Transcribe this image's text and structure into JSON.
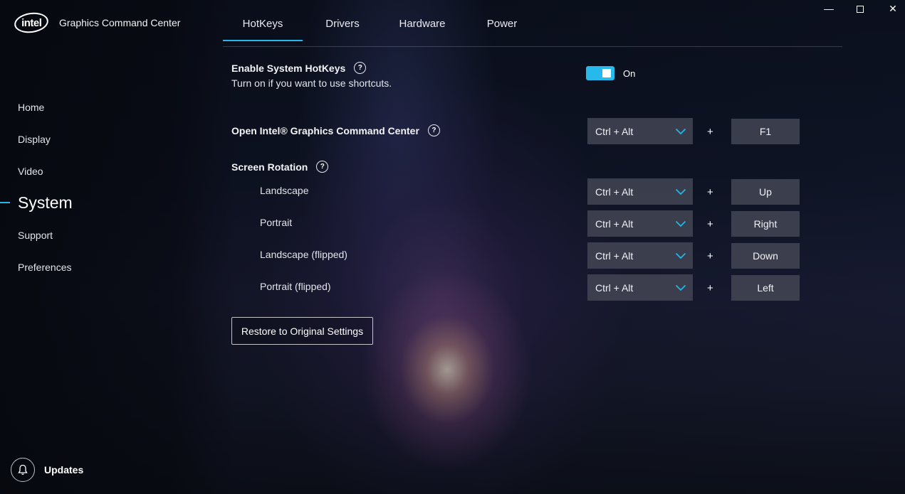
{
  "app": {
    "logo_text": "intel",
    "title": "Graphics Command Center"
  },
  "window_controls": {
    "minimize": "—",
    "close": "✕"
  },
  "tabs": [
    {
      "label": "HotKeys",
      "active": true
    },
    {
      "label": "Drivers",
      "active": false
    },
    {
      "label": "Hardware",
      "active": false
    },
    {
      "label": "Power",
      "active": false
    }
  ],
  "sidebar": {
    "items": [
      {
        "label": "Home"
      },
      {
        "label": "Display"
      },
      {
        "label": "Video"
      },
      {
        "label": "System",
        "active": true
      },
      {
        "label": "Support"
      },
      {
        "label": "Preferences"
      }
    ],
    "updates_label": "Updates"
  },
  "enable_hotkeys": {
    "title": "Enable System HotKeys",
    "description": "Turn on if you want to use shortcuts.",
    "state_label": "On",
    "enabled": true
  },
  "open_gcc": {
    "title": "Open Intel® Graphics Command Center",
    "modifier": "Ctrl + Alt",
    "key": "F1"
  },
  "screen_rotation": {
    "title": "Screen Rotation",
    "rows": [
      {
        "label": "Landscape",
        "modifier": "Ctrl + Alt",
        "key": "Up"
      },
      {
        "label": "Portrait",
        "modifier": "Ctrl + Alt",
        "key": "Right"
      },
      {
        "label": "Landscape (flipped)",
        "modifier": "Ctrl + Alt",
        "key": "Down"
      },
      {
        "label": "Portrait (flipped)",
        "modifier": "Ctrl + Alt",
        "key": "Left"
      }
    ]
  },
  "plus_sign": "+",
  "help_glyph": "?",
  "restore_button": "Restore to Original Settings",
  "colors": {
    "accent": "#23b6e8",
    "toggle_on": "#28b9ec",
    "control_bg": "#464856"
  }
}
